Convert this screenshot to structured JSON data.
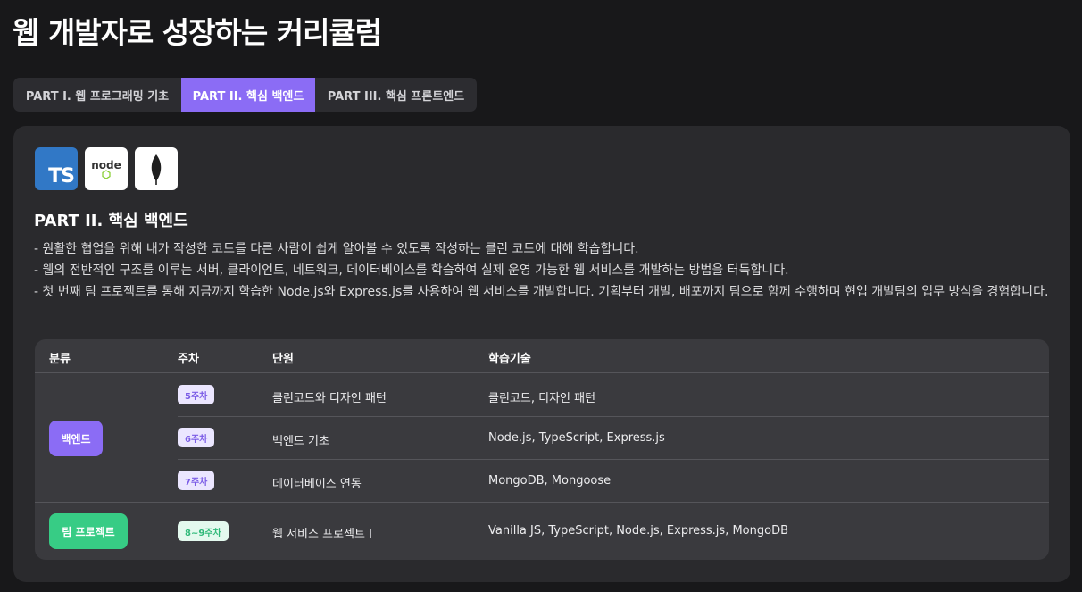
{
  "page": {
    "title": "웹 개발자로 성장하는 커리큘럼"
  },
  "tabs": [
    {
      "label": "PART I. 웹 프로그래밍 기초",
      "active": false
    },
    {
      "label": "PART II. 핵심 백엔드",
      "active": true
    },
    {
      "label": "PART III. 핵심 프론트엔드",
      "active": false
    }
  ],
  "section": {
    "icons": [
      "typescript-icon",
      "nodejs-icon",
      "mongodb-icon"
    ],
    "ts_icon_text": "TS",
    "node_icon_text": "node",
    "title": "PART II. 핵심 백엔드",
    "desc": [
      "- 원활한 협업을 위해 내가 작성한 코드를 다른 사람이 쉽게 알아볼 수 있도록 작성하는 클린 코드에 대해 학습합니다.",
      "- 웹의 전반적인 구조를 이루는 서버, 클라이언트, 네트워크, 데이터베이스를 학습하여 실제 운영 가능한 웹 서비스를 개발하는 방법을 터득합니다.",
      "- 첫 번째 팀 프로젝트를 통해 지금까지 학습한 Node.js와 Express.js를 사용하여 웹 서비스를 개발합니다. 기획부터 개발, 배포까지 팀으로 함께 수행하며 현업 개발팀의 업무 방식을 경험합니다."
    ]
  },
  "table": {
    "headers": [
      "분류",
      "주차",
      "단원",
      "학습기술"
    ],
    "categories": [
      {
        "label": "백엔드",
        "color": "#8b6cf5"
      },
      {
        "label": "팀 프로젝트",
        "color": "#37cc85"
      }
    ],
    "rows": [
      {
        "week": "5주차",
        "unit": "클린코드와 디자인 패턴",
        "tech": "클린코드, 디자인 패턴"
      },
      {
        "week": "6주차",
        "unit": "백엔드 기초",
        "tech": "Node.js, TypeScript, Express.js"
      },
      {
        "week": "7주차",
        "unit": "데이터베이스 연동",
        "tech": "MongoDB, Mongoose"
      },
      {
        "week": "8~9주차",
        "unit": "웹 서비스 프로젝트 I",
        "tech": "Vanilla JS, TypeScript, Node.js, Express.js, MongoDB"
      }
    ]
  },
  "colors": {
    "accent": "#8b6cf5",
    "team": "#37cc85",
    "typescript": "#3178c6",
    "mongodb_leaf": "#1f1f1f"
  }
}
